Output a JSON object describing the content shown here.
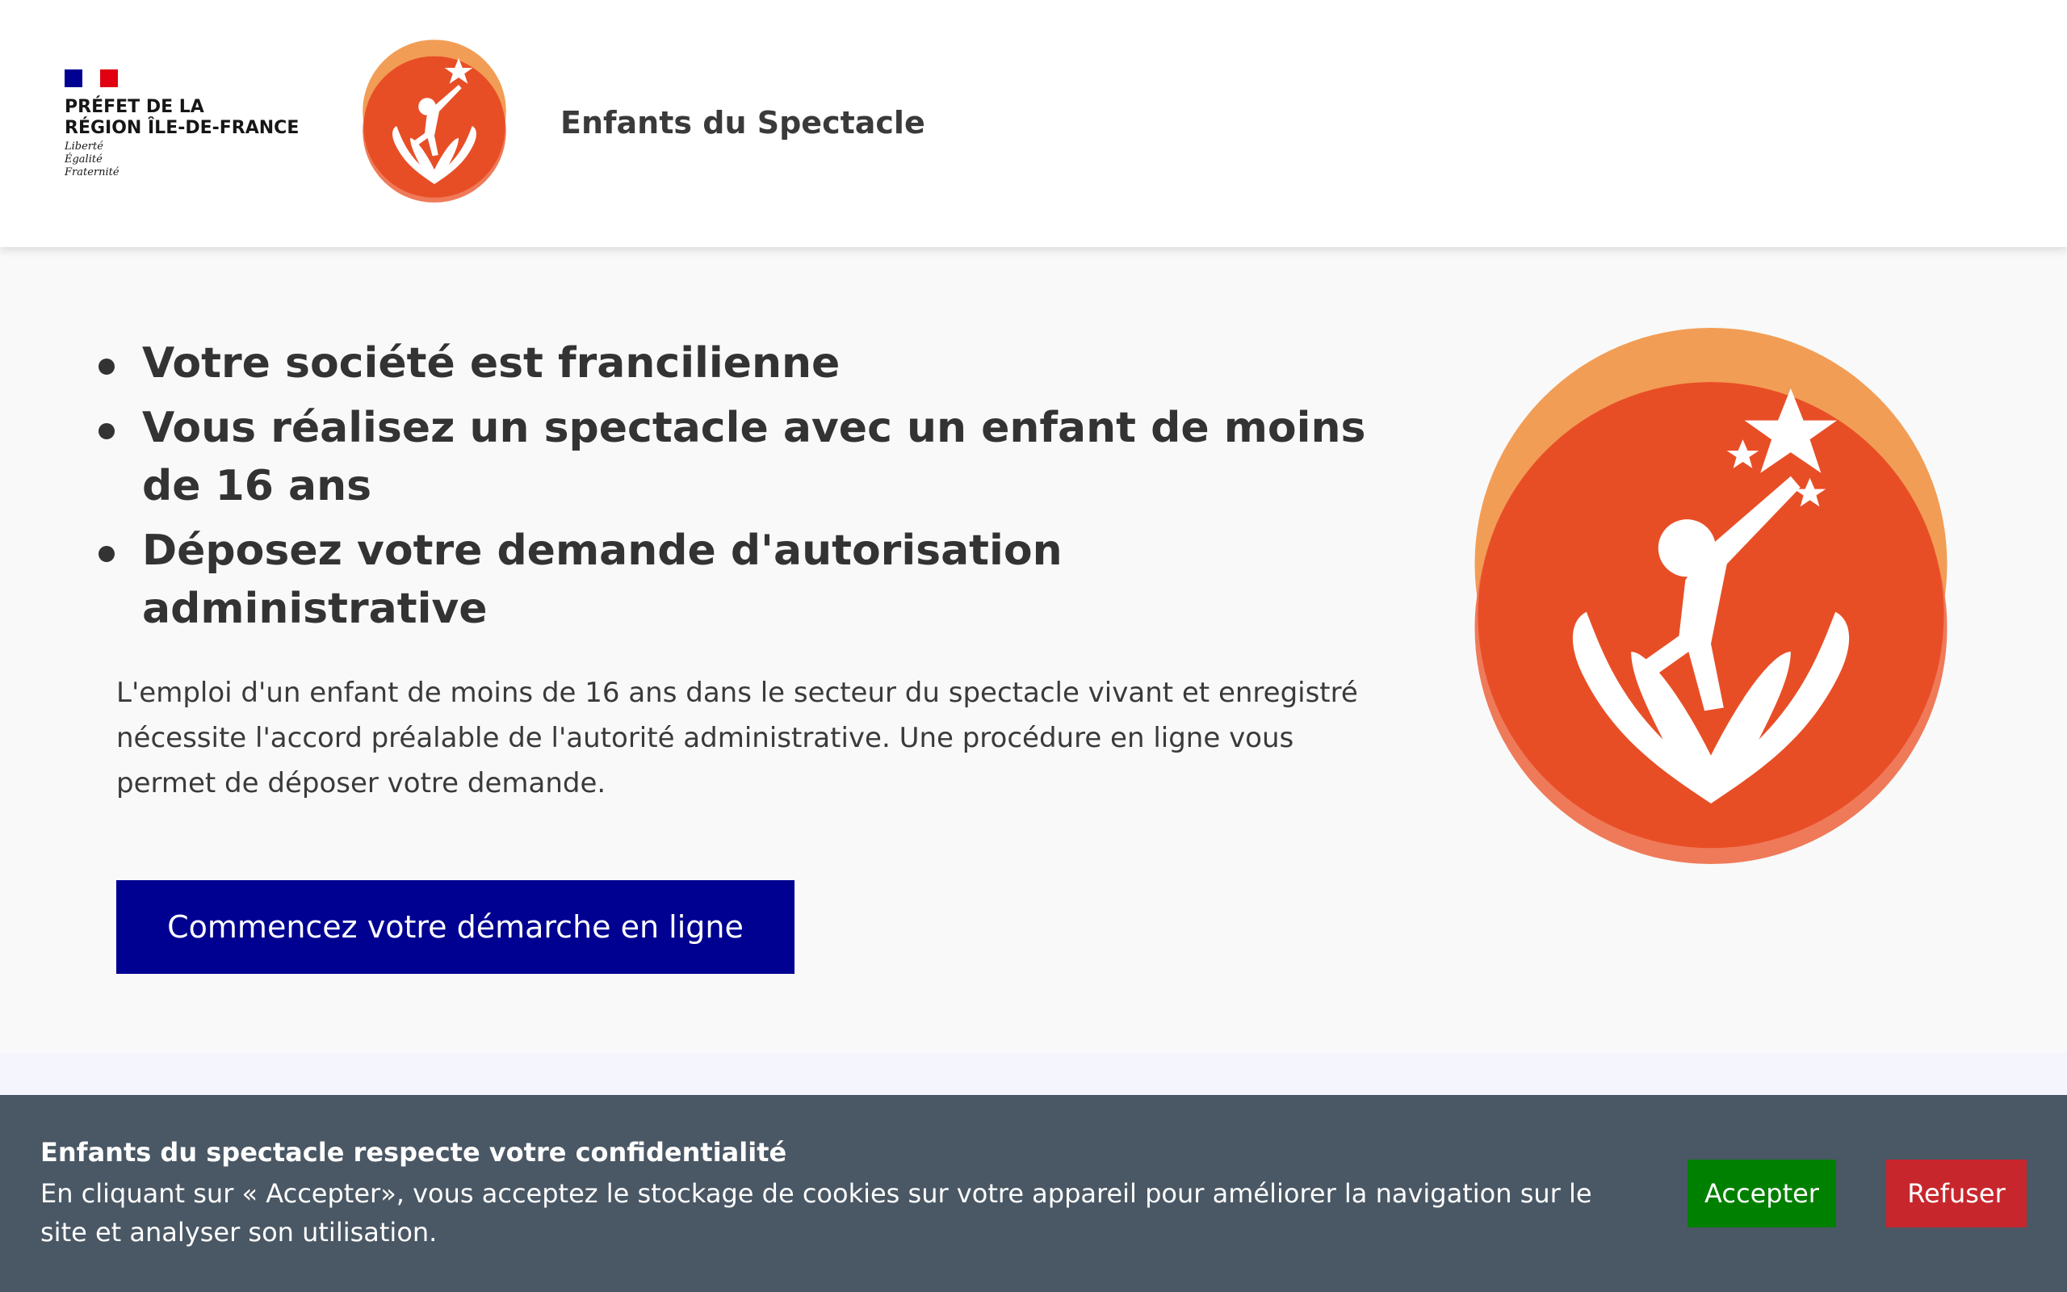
{
  "header": {
    "gov_title_line1": "PRÉFET DE LA",
    "gov_title_line2": "RÉGION ÎLE-DE-FRANCE",
    "motto": [
      "Liberté",
      "Égalité",
      "Fraternité"
    ],
    "site_title": "Enfants du Spectacle",
    "logo_icon": "child-reaching-star-hands-icon"
  },
  "main": {
    "bullets": [
      "Votre société est francilienne",
      "Vous réalisez un spectacle avec un enfant de moins de 16 ans",
      "Déposez votre demande d'autorisation administrative"
    ],
    "description": "L'emploi d'un enfant de moins de 16 ans dans le secteur du spectacle vivant et enregistré nécessite l'accord préalable de l'autorité administrative. Une procédure en ligne vous permet de déposer votre demande.",
    "cta_label": "Commencez votre démarche en ligne"
  },
  "cookie": {
    "title": "Enfants du spectacle respecte votre confidentialité",
    "text": "En cliquant sur « Accepter», vous acceptez le stockage de cookies sur votre appareil pour améliorer la navigation sur le site et analyser son utilisation.",
    "accept_label": "Accepter",
    "refuse_label": "Refuser"
  },
  "colors": {
    "primary_blue": "#000091",
    "accept_green": "#008000",
    "refuse_red": "#c8262d",
    "banner_bg": "#4a5764",
    "logo_orange_light": "#f29d55",
    "logo_orange": "#e84e26",
    "flag_blue": "#000091",
    "flag_red": "#e1000f"
  }
}
